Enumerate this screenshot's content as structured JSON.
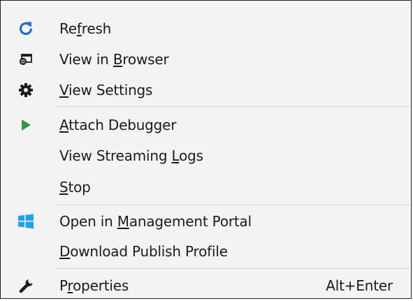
{
  "menu": {
    "items": [
      {
        "pre": "Re",
        "key": "f",
        "post": "resh",
        "icon": "refresh-icon"
      },
      {
        "pre": "View in ",
        "key": "B",
        "post": "rowser",
        "icon": "browser-window-icon"
      },
      {
        "pre": "",
        "key": "V",
        "post": "iew Settings",
        "icon": "gear-icon"
      },
      {
        "pre": "",
        "key": "A",
        "post": "ttach Debugger",
        "icon": "play-icon"
      },
      {
        "pre": "View Streaming ",
        "key": "L",
        "post": "ogs",
        "icon": ""
      },
      {
        "pre": "",
        "key": "S",
        "post": "top",
        "icon": ""
      },
      {
        "pre": "Open in ",
        "key": "M",
        "post": "anagement Portal",
        "icon": "windows-logo-icon"
      },
      {
        "pre": "",
        "key": "D",
        "post": "ownload Publish Profile",
        "icon": ""
      },
      {
        "pre": "P",
        "key": "r",
        "post": "operties",
        "icon": "wrench-icon",
        "shortcut": "Alt+Enter"
      }
    ]
  },
  "colors": {
    "refresh_icon": "#1e6fc9",
    "play_icon": "#2e9a3a",
    "windows_logo": "#1fa3e8",
    "dark_icon": "#1b1b1b"
  }
}
